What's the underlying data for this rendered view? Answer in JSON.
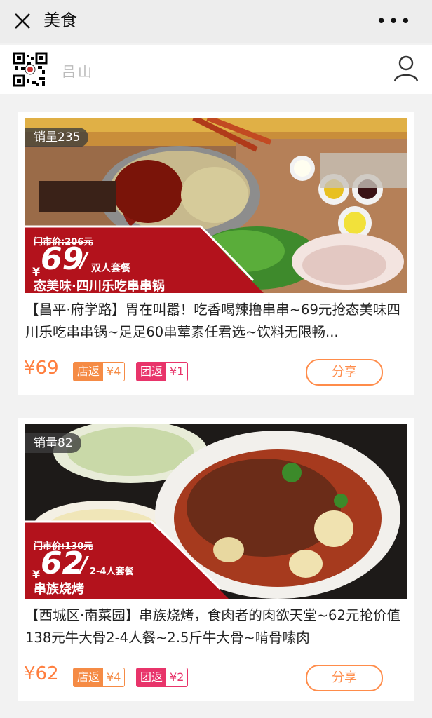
{
  "header": {
    "title": "美食",
    "close_icon": "close-icon",
    "more_icon": "more-icon"
  },
  "shop": {
    "name": "吕山",
    "qr_icon": "qr-code-icon",
    "user_icon": "user-icon"
  },
  "deals": [
    {
      "sales": "销量235",
      "banner": {
        "old_price": "门市价:206元",
        "yen": "¥",
        "price": "69",
        "slash": "/",
        "package": "双人套餐",
        "name": "态美味·四川乐吃串串锅"
      },
      "description": "【昌平·府学路】胃在叫嚣！吃香喝辣撸串串~69元抢态美味四川乐吃串串锅~足足60串荤素任君选~饮料无限畅...",
      "price": "¥69",
      "shop_rebate": {
        "label": "店返",
        "amount": "¥4"
      },
      "group_rebate": {
        "label": "团返",
        "amount": "¥1"
      },
      "share": "分享"
    },
    {
      "sales": "销量82",
      "banner": {
        "old_price": "门市价:130元",
        "yen": "¥",
        "price": "62",
        "slash": "/",
        "package": "2-4人套餐",
        "name": "串族烧烤"
      },
      "description": "【西城区·南菜园】串族烧烤，食肉者的肉欲天堂~62元抢价值138元牛大骨2-4人餐~2.5斤牛大骨~啃骨嗦肉",
      "price": "¥62",
      "shop_rebate": {
        "label": "店返",
        "amount": "¥4"
      },
      "group_rebate": {
        "label": "团返",
        "amount": "¥2"
      },
      "share": "分享"
    }
  ],
  "colors": {
    "accent": "#ff7e3e",
    "shop_badge": "#f58b45",
    "group_badge": "#e8346a",
    "banner_red": "#b3121c"
  }
}
